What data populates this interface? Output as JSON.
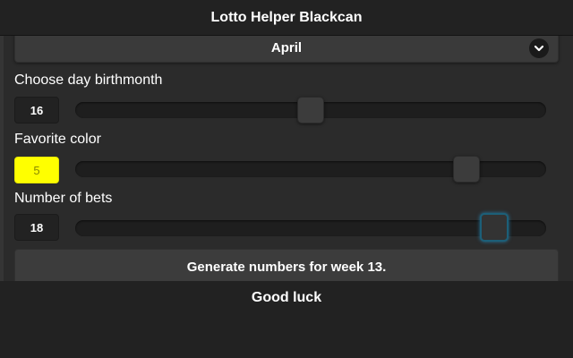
{
  "app": {
    "title": "Lotto Helper Blackcan"
  },
  "month_select": {
    "selected": "April",
    "icon": "chevron-down-icon"
  },
  "birthday": {
    "label": "Choose day birthmonth",
    "value": "16",
    "slider_fraction": 0.5
  },
  "favorite_color": {
    "label": "Favorite color",
    "value": "5",
    "color": "#ffff00",
    "slider_fraction": 0.83
  },
  "bets": {
    "label": "Number of bets",
    "value": "18",
    "slider_fraction": 0.89,
    "focused": true
  },
  "generate_button": {
    "label": "Generate numbers for week 13."
  },
  "footer": {
    "text": "Good luck"
  },
  "colors": {
    "background": "#262626",
    "header": "#222222",
    "focus": "#1c5f78"
  }
}
